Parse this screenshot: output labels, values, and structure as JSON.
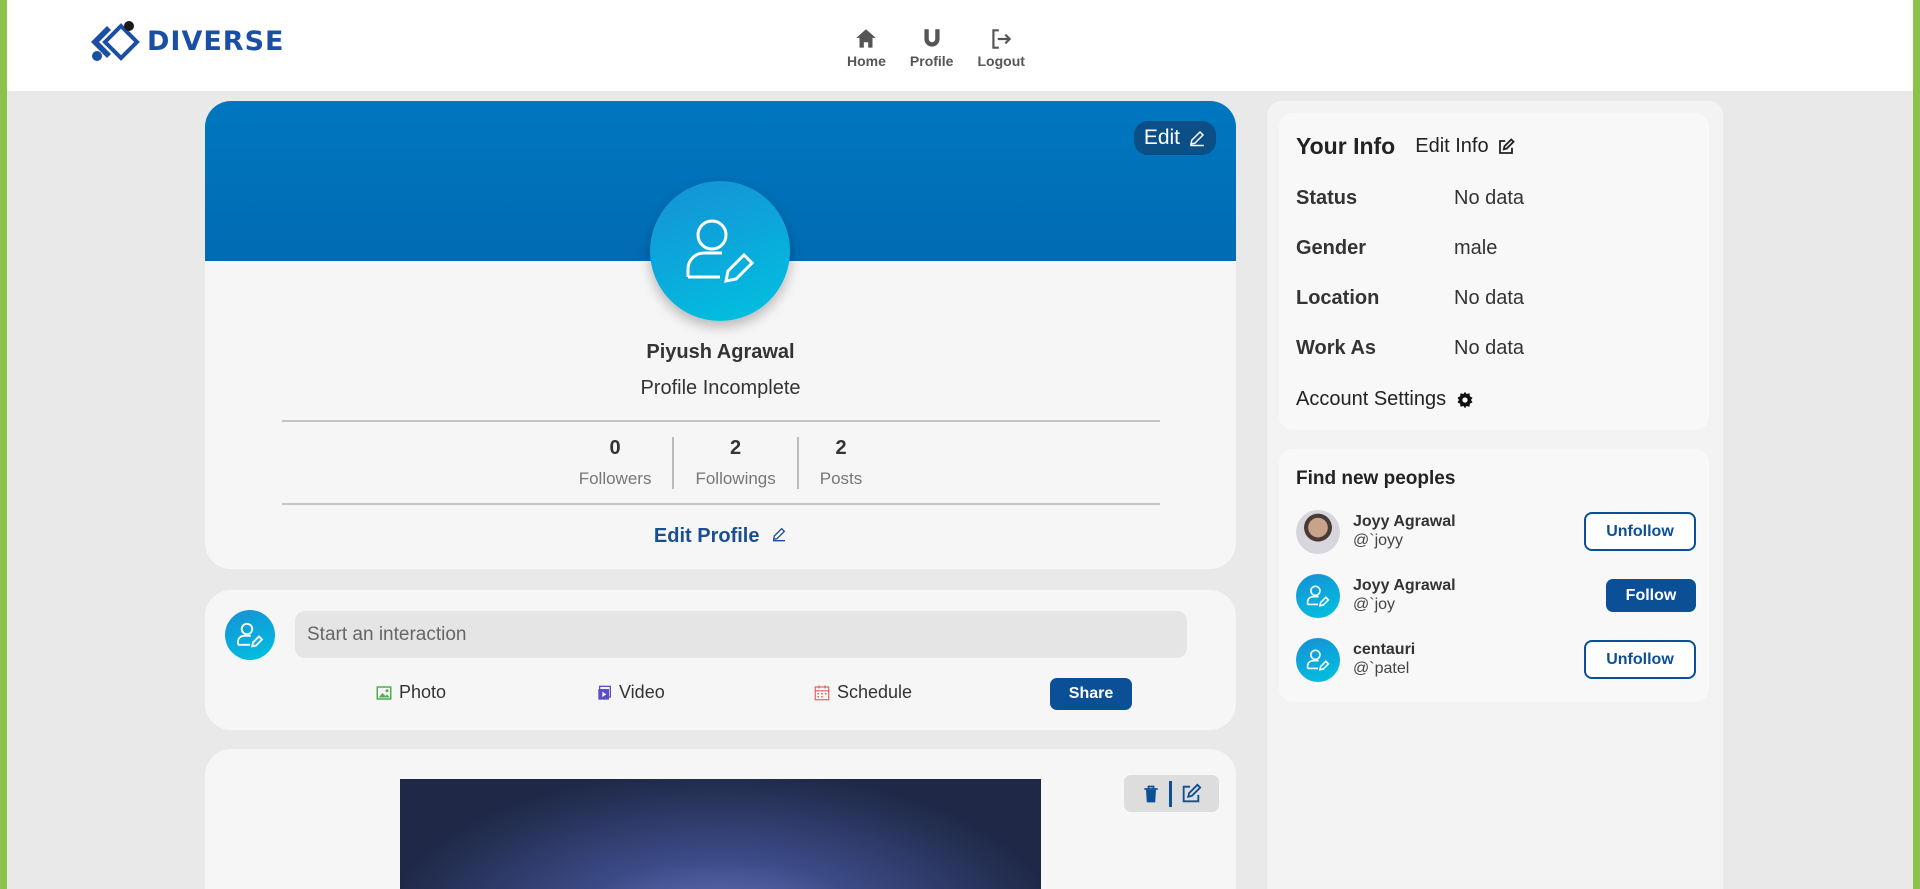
{
  "brand": {
    "name": "DIVERSE",
    "color": "#1a4fa3"
  },
  "nav": [
    {
      "label": "Home",
      "icon": "home-icon"
    },
    {
      "label": "Profile",
      "icon": "profile-magnet-icon"
    },
    {
      "label": "Logout",
      "icon": "logout-icon"
    }
  ],
  "profile": {
    "edit_label": "Edit",
    "name": "Piyush Agrawal",
    "status": "Profile Incomplete",
    "stats": [
      {
        "value": "0",
        "label": "Followers"
      },
      {
        "value": "2",
        "label": "Followings"
      },
      {
        "value": "2",
        "label": "Posts"
      }
    ],
    "edit_profile_label": "Edit Profile"
  },
  "composer": {
    "placeholder": "Start an interaction",
    "options": [
      {
        "label": "Photo",
        "icon": "image-icon",
        "color": "#4caf50"
      },
      {
        "label": "Video",
        "icon": "video-icon",
        "color": "#5b4fc9"
      },
      {
        "label": "Schedule",
        "icon": "calendar-icon",
        "color": "#e05a5a"
      }
    ],
    "share_label": "Share"
  },
  "info": {
    "title": "Your Info",
    "edit_label": "Edit Info",
    "rows": [
      {
        "key": "Status",
        "value": "No data"
      },
      {
        "key": "Gender",
        "value": "male"
      },
      {
        "key": "Location",
        "value": "No data"
      },
      {
        "key": "Work As",
        "value": "No data"
      }
    ],
    "account_settings": "Account Settings"
  },
  "find": {
    "title": "Find new peoples",
    "people": [
      {
        "name": "Joyy Agrawal",
        "handle": "@`joyy",
        "action": "Unfollow"
      },
      {
        "name": "Joyy Agrawal",
        "handle": "@`joy",
        "action": "Follow"
      },
      {
        "name": "centauri",
        "handle": "@`patel",
        "action": "Unfollow"
      }
    ]
  },
  "colors": {
    "accent": "#0b4f96",
    "banner": "#0077c0",
    "frame": "#8bc34a"
  }
}
